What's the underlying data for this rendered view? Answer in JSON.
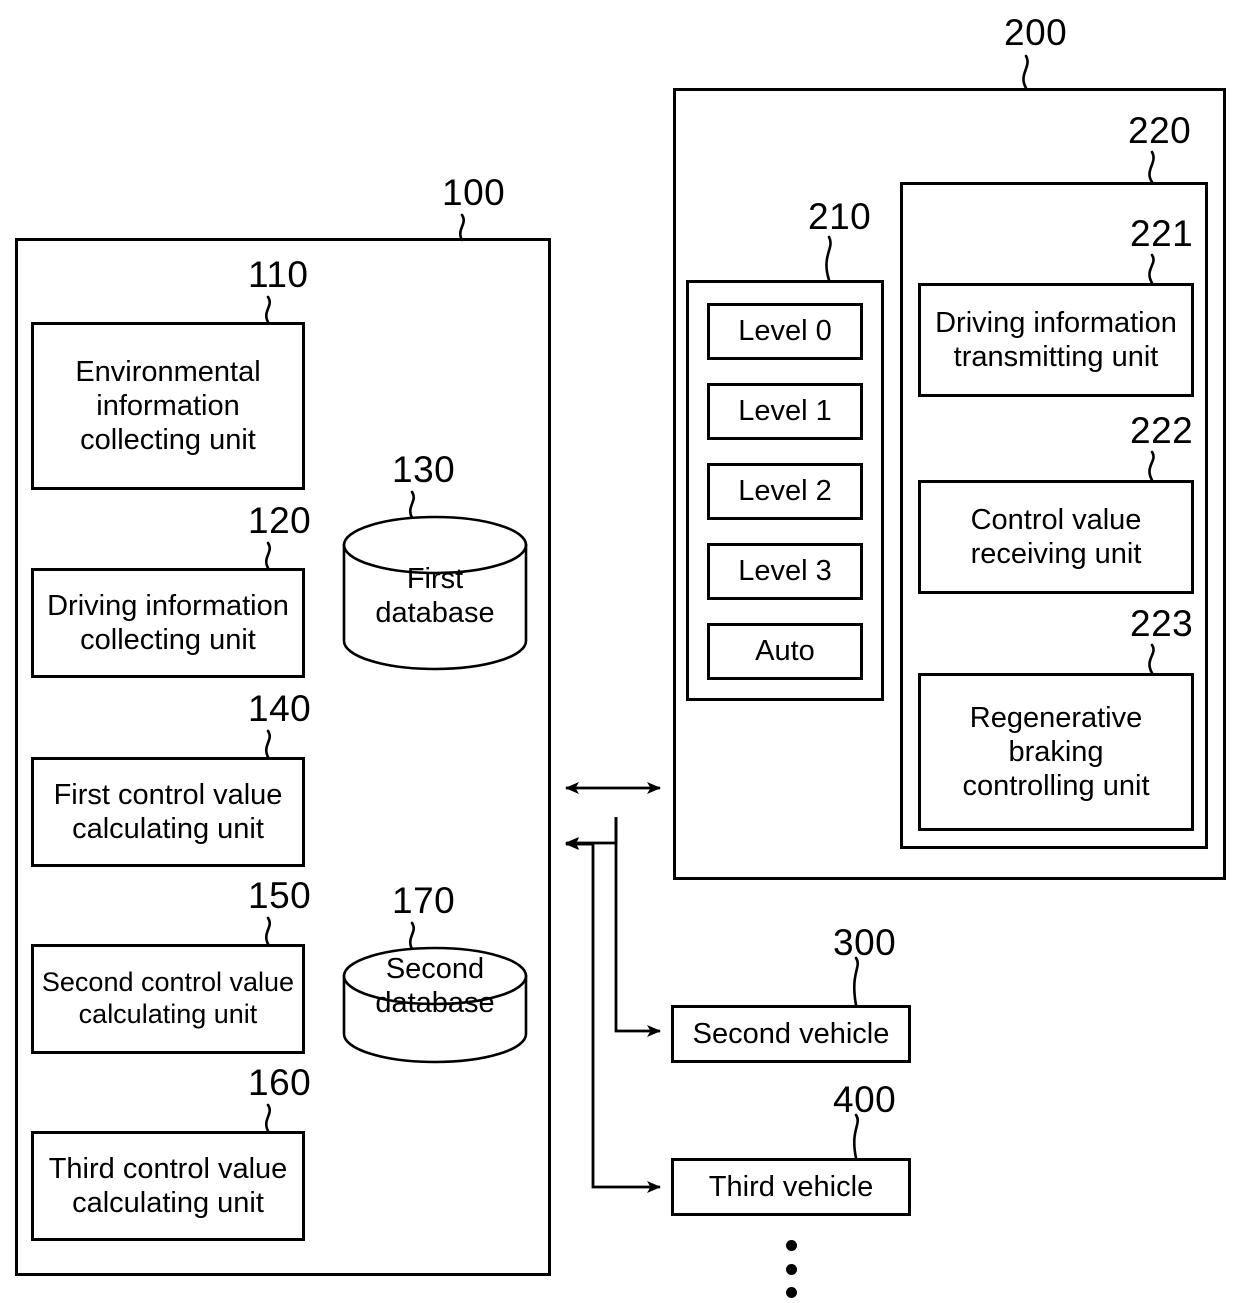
{
  "figure": {
    "type": "patent-block-diagram",
    "background": "#ffffff",
    "stroke": "#000000"
  },
  "blocks": {
    "first_vehicle": {
      "ref": "100",
      "children": {
        "environmental_information_collecting_unit": {
          "ref": "110",
          "label": "Environmental\ninformation\ncollecting unit"
        },
        "driving_information_collecting_unit": {
          "ref": "120",
          "label": "Driving information\ncollecting unit"
        },
        "first_database": {
          "ref": "130",
          "label": "First\ndatabase"
        },
        "first_control_value_calculating_unit": {
          "ref": "140",
          "label": "First control value\ncalculating unit"
        },
        "second_control_value_calculating_unit": {
          "ref": "150",
          "label": "Second control value\ncalculating unit"
        },
        "third_control_value_calculating_unit": {
          "ref": "160",
          "label": "Third control value\ncalculating unit"
        },
        "second_database": {
          "ref": "170",
          "label": "Second\ndatabase"
        }
      }
    },
    "server_system": {
      "ref": "200",
      "children": {
        "level_selector": {
          "ref": "210",
          "options": [
            {
              "label": "Level 0"
            },
            {
              "label": "Level 1"
            },
            {
              "label": "Level 2"
            },
            {
              "label": "Level 3"
            },
            {
              "label": "Auto"
            }
          ]
        },
        "control_module": {
          "ref": "220",
          "children": {
            "driving_information_transmitting_unit": {
              "ref": "221",
              "label": "Driving information\ntransmitting unit"
            },
            "control_value_receiving_unit": {
              "ref": "222",
              "label": "Control value\nreceiving unit"
            },
            "regenerative_braking_controlling_unit": {
              "ref": "223",
              "label": "Regenerative\nbraking\ncontrolling unit"
            }
          }
        }
      }
    },
    "second_vehicle": {
      "ref": "300",
      "label": "Second vehicle"
    },
    "third_vehicle": {
      "ref": "400",
      "label": "Third vehicle"
    },
    "continuation": {
      "label": "vertical-ellipsis"
    }
  }
}
